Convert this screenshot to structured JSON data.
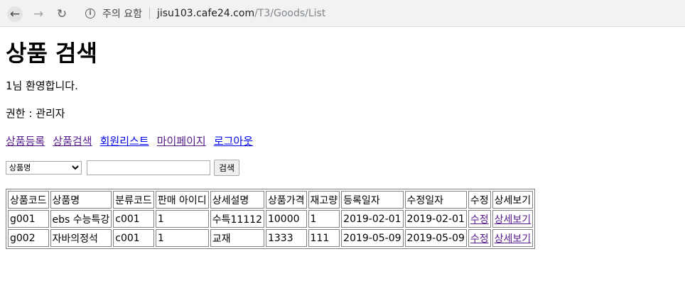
{
  "browser": {
    "back_icon": "←",
    "forward_icon": "→",
    "reload_icon": "↻",
    "info_icon": "i",
    "security_label": "주의 요함",
    "url_host": "jisu103.cafe24.com",
    "url_path": "/T3/Goods/List"
  },
  "page": {
    "title": "상품 검색",
    "welcome": "1님 환영합니다.",
    "role": "권한 : 관리자"
  },
  "nav_links": {
    "register": "상품등록",
    "search": "상품검색",
    "members": "회원리스트",
    "mypage": "마이페이지",
    "logout": "로그아웃"
  },
  "search": {
    "selected_option": "상품명",
    "input_value": "",
    "button_label": "검색"
  },
  "table": {
    "headers": [
      "상품코드",
      "상품명",
      "분류코드",
      "판매 아이디",
      "상세설명",
      "상품가격",
      "재고량",
      "등록일자",
      "수정일자",
      "수정",
      "상세보기"
    ],
    "rows": [
      {
        "code": "g001",
        "name": "ebs 수능특강",
        "category": "c001",
        "seller": "1",
        "desc": "수특11112",
        "price": "10000",
        "stock": "1",
        "reg_date": "2019-02-01",
        "mod_date": "2019-02-01",
        "edit": "수정",
        "detail": "상세보기"
      },
      {
        "code": "g002",
        "name": "자바의정석",
        "category": "c001",
        "seller": "1",
        "desc": "교재",
        "price": "1333",
        "stock": "111",
        "reg_date": "2019-05-09",
        "mod_date": "2019-05-09",
        "edit": "수정",
        "detail": "상세보기"
      }
    ]
  }
}
